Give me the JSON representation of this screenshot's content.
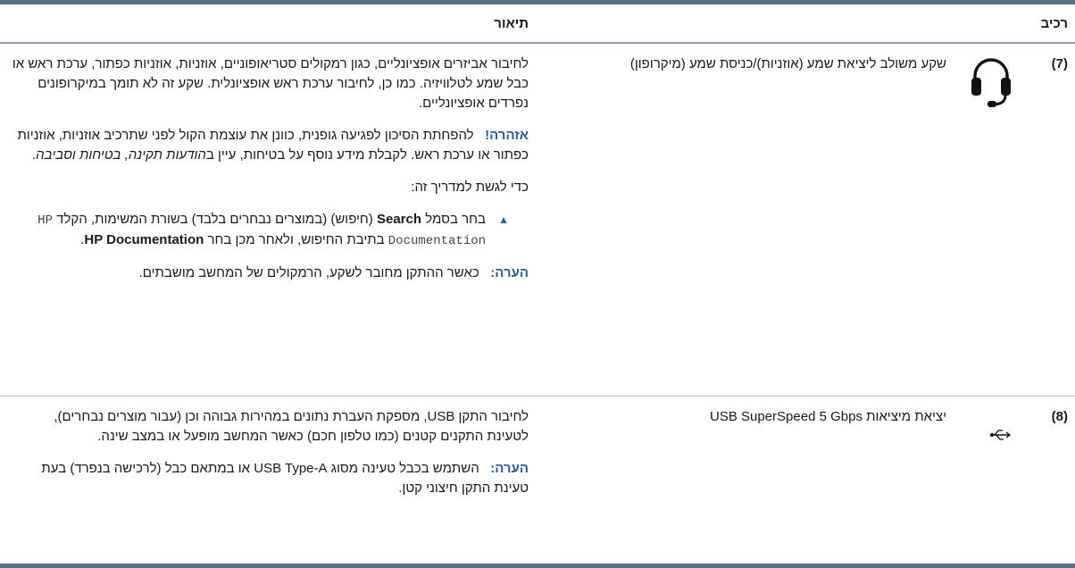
{
  "header": {
    "component": "רכיב",
    "description": "תיאור"
  },
  "rows": [
    {
      "number": "(7)",
      "icon": "headset-icon",
      "name": "שקע משולב ליציאת שמע (אוזניות)/כניסת שמע (מיקרופון)",
      "p1": "לחיבור אביזרים אופציונליים, כגון רמקולים סטריאופוניים, אוזניות, אוזניות כפתור, ערכת ראש או כבל שמע לטלוויזיה. כמו כן, לחיבור ערכת ראש אופציונלית. שקע זה לא תומך במיקרופונים נפרדים אופציונליים.",
      "warning_label": "אזהרה!",
      "warning_text": "להפחתת הסיכון לפגיעה גופנית, כוונן את עוצמת הקול לפני שתרכיב אוזניות, אוזניות כפתור או ערכת ראש. לקבלת מידע נוסף על בטיחות, עיין ב",
      "warning_link": "הודעות תקינה, בטיחות וסביבה",
      "warning_end": ".",
      "access_intro": "כדי לגשת למדריך זה:",
      "step_prefix": "בחר בסמל ",
      "step_search": "Search",
      "step_mid1": " (חיפוש) (במוצרים נבחרים בלבד) בשורת המשימות, הקלד ",
      "step_code": "HP Documentation",
      "step_mid2": " בתיבת החיפוש, ולאחר מכן בחר ",
      "step_doc": "HP Documentation",
      "step_end": ".",
      "note_label": "הערה:",
      "note_text": "כאשר ההתקן מחובר לשקע, הרמקולים של המחשב מושבתים."
    },
    {
      "number": "(8)",
      "icon": "usb-superspeed-icon",
      "name": "יציאת מיציאות USB SuperSpeed 5 Gbps",
      "p1": "לחיבור התקן USB, מספקת העברת נתונים במהירות גבוהה וכן (עבור מוצרים נבחרים), לטעינת התקנים קטנים (כמו טלפון חכם) כאשר המחשב מופעל או במצב שינה.",
      "note_label": "הערה:",
      "note_text": "השתמש בכבל טעינה מסוג USB Type-A או במתאם כבל (לרכישה בנפרד) בעת טעינת התקן חיצוני קטן."
    }
  ]
}
